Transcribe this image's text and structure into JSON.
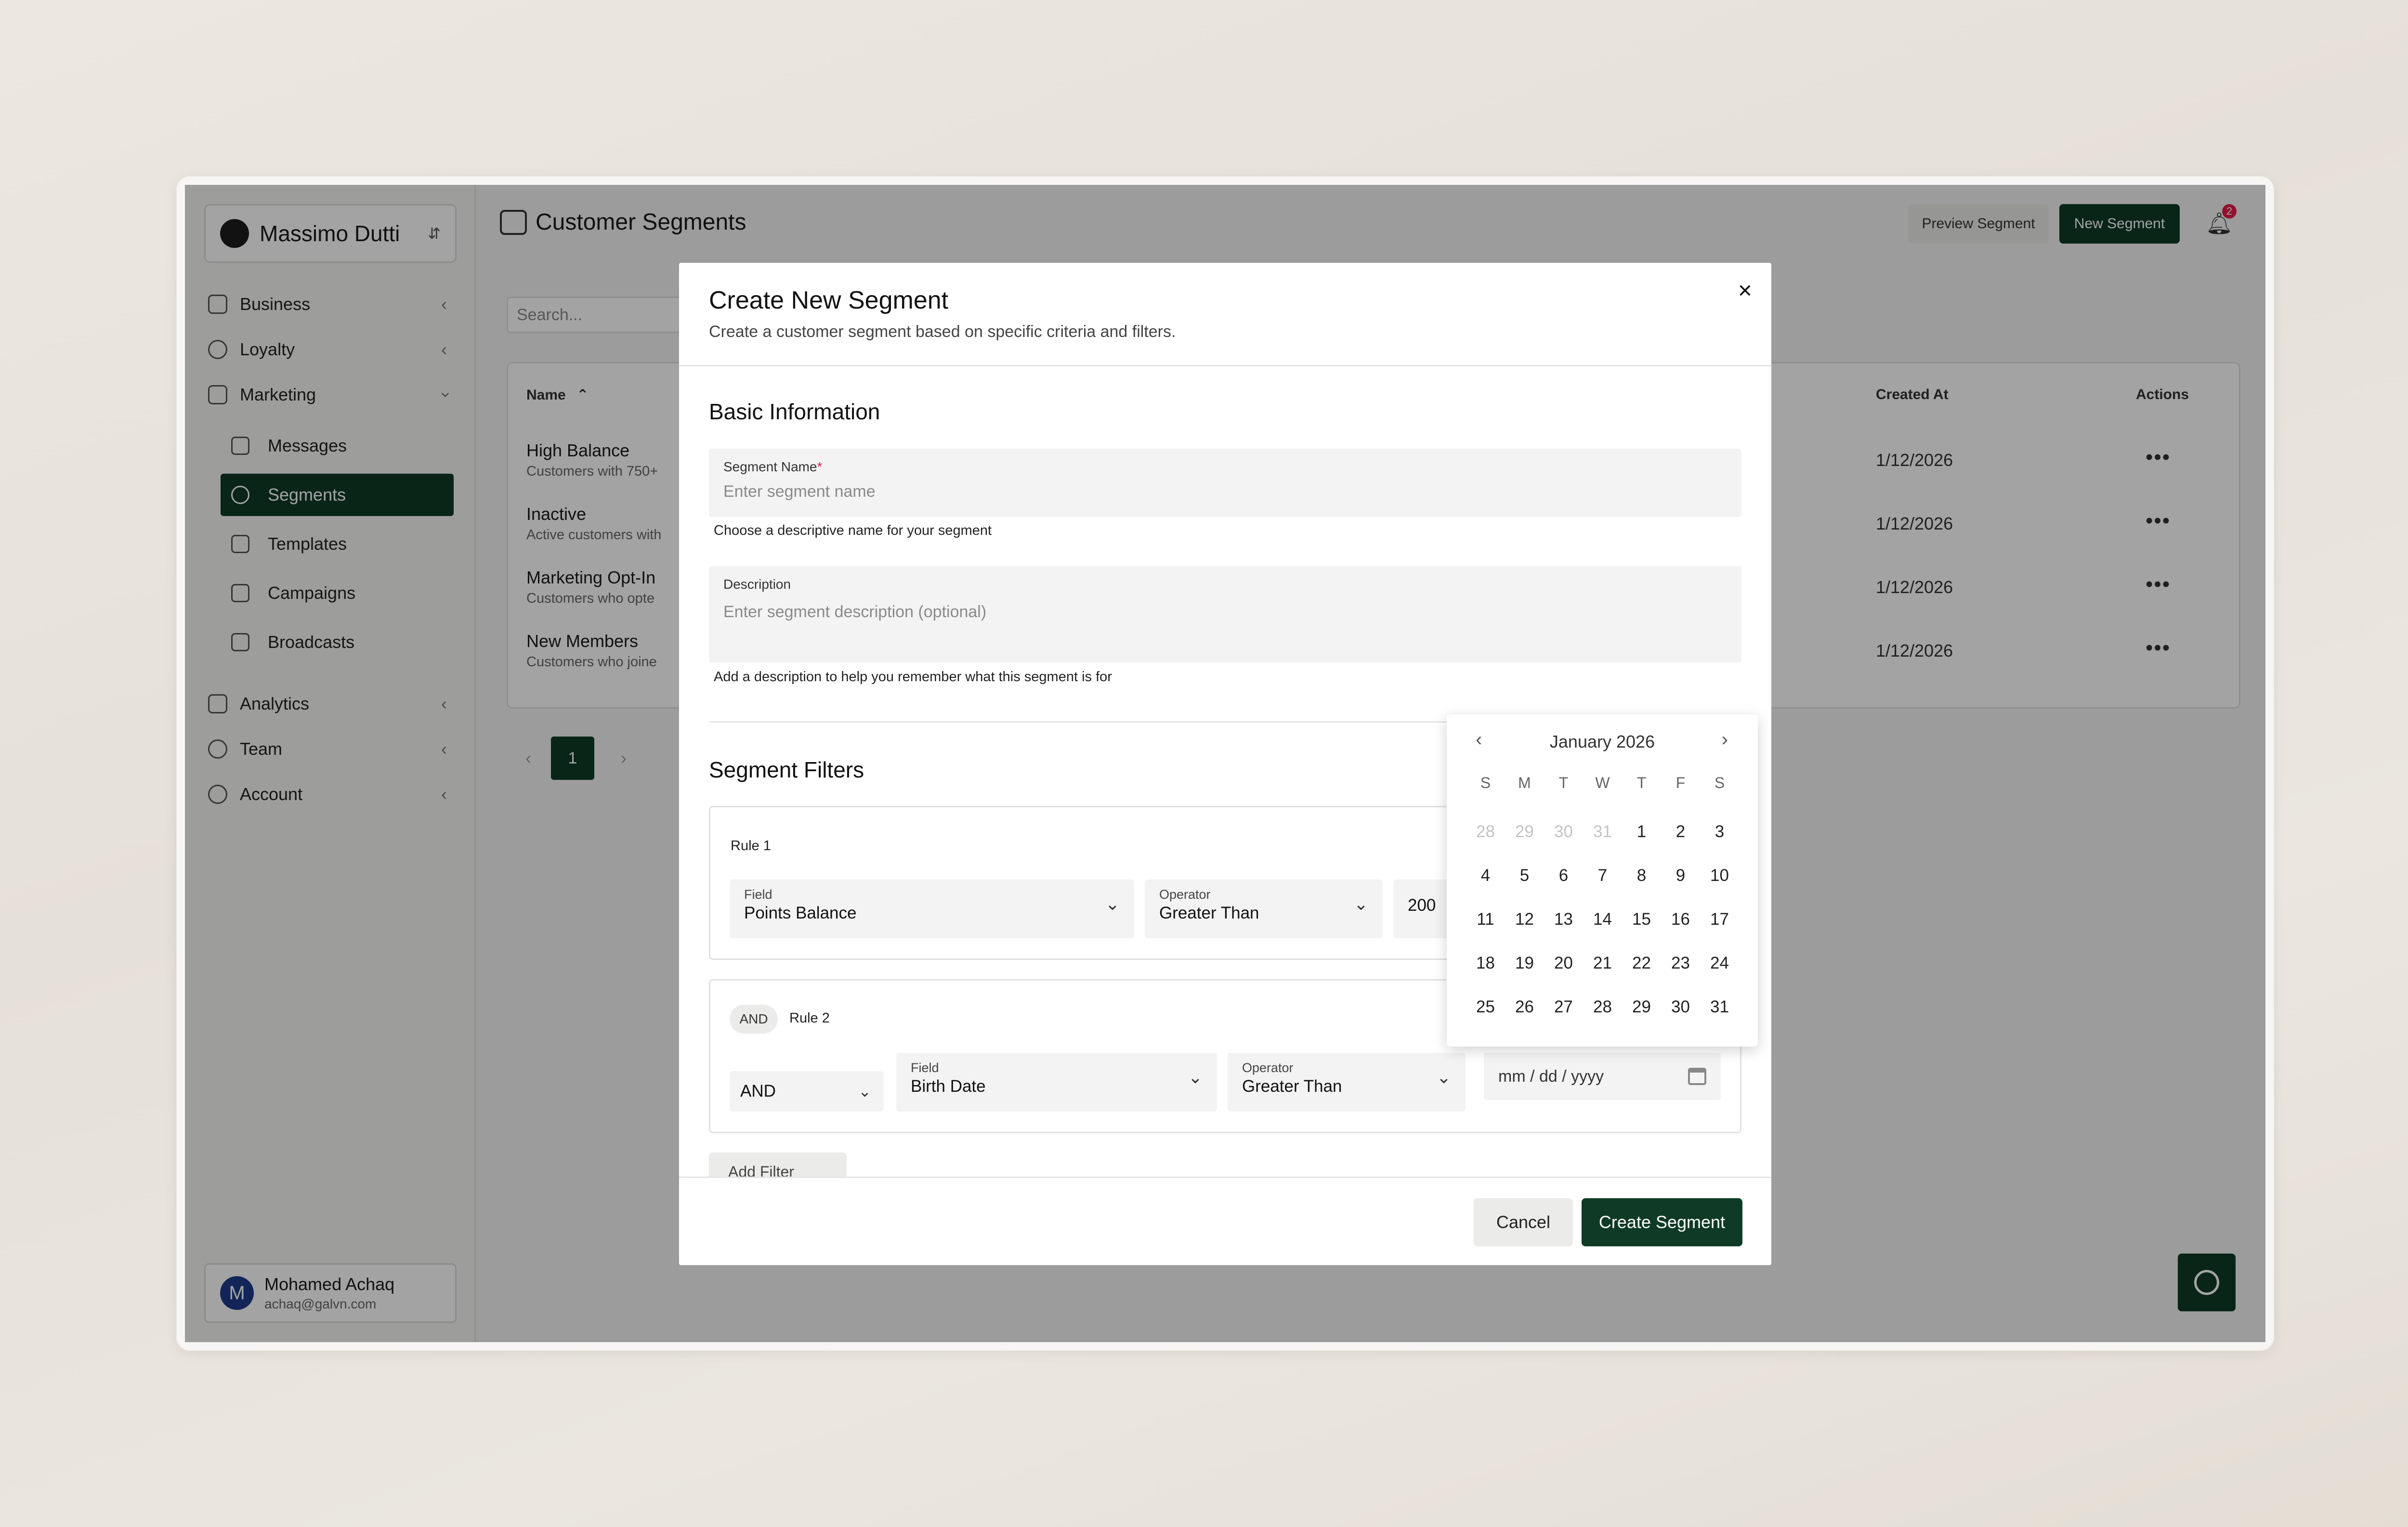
{
  "brand": {
    "name": "Massimo Dutti"
  },
  "sidebar": {
    "items": [
      {
        "label": "Business"
      },
      {
        "label": "Loyalty"
      },
      {
        "label": "Marketing"
      },
      {
        "label": "Analytics"
      },
      {
        "label": "Team"
      },
      {
        "label": "Account"
      }
    ],
    "marketing_sub": [
      {
        "label": "Messages"
      },
      {
        "label": "Segments"
      },
      {
        "label": "Templates"
      },
      {
        "label": "Campaigns"
      },
      {
        "label": "Broadcasts"
      }
    ],
    "user": {
      "initial": "M",
      "name": "Mohamed Achaq",
      "email": "achaq@galvn.com"
    }
  },
  "header": {
    "title": "Customer Segments",
    "preview_label": "Preview Segment",
    "new_label": "New Segment",
    "notification_count": "2"
  },
  "search": {
    "placeholder": "Search..."
  },
  "table": {
    "headers": {
      "name": "Name",
      "created_at": "Created At",
      "actions": "Actions"
    },
    "sort_glyph": "⌃",
    "rows": [
      {
        "name": "High Balance",
        "desc": "Customers with 750+",
        "created": "1/12/2026"
      },
      {
        "name": "Inactive",
        "desc": "Active customers with",
        "created": "1/12/2026"
      },
      {
        "name": "Marketing Opt-In",
        "desc": "Customers who opte",
        "created": "1/12/2026"
      },
      {
        "name": "New Members",
        "desc": "Customers who joine",
        "created": "1/12/2026"
      }
    ],
    "actions_glyph": "•••"
  },
  "pagination": {
    "prev": "‹",
    "current": "1",
    "next": "›"
  },
  "modal": {
    "title": "Create New Segment",
    "subtitle": "Create a customer segment based on specific criteria and filters.",
    "close_glyph": "×",
    "basic_info_title": "Basic Information",
    "segment_name": {
      "label": "Segment Name",
      "required_mark": "*",
      "placeholder": "Enter segment name",
      "helper": "Choose a descriptive name for your segment"
    },
    "description": {
      "label": "Description",
      "placeholder": "Enter segment description (optional)",
      "helper": "Add a description to help you remember what this segment is for"
    },
    "filters_title": "Segment Filters",
    "rule1": {
      "label": "Rule 1",
      "field_label": "Field",
      "field_value": "Points Balance",
      "operator_label": "Operator",
      "operator_value": "Greater Than",
      "value": "200"
    },
    "rule2": {
      "chip": "AND",
      "label": "Rule 2",
      "connector": "AND",
      "field_label": "Field",
      "field_value": "Birth Date",
      "operator_label": "Operator",
      "operator_value": "Greater Than",
      "date_placeholder": "mm / dd / yyyy"
    },
    "add_filter": "Add Filter",
    "cancel": "Cancel",
    "create": "Create Segment"
  },
  "calendar": {
    "month": "January 2026",
    "prev": "‹",
    "next": "›",
    "days_of_week": [
      "S",
      "M",
      "T",
      "W",
      "T",
      "F",
      "S"
    ],
    "weeks": [
      [
        "28",
        "29",
        "30",
        "31",
        "1",
        "2",
        "3"
      ],
      [
        "4",
        "5",
        "6",
        "7",
        "8",
        "9",
        "10"
      ],
      [
        "11",
        "12",
        "13",
        "14",
        "15",
        "16",
        "17"
      ],
      [
        "18",
        "19",
        "20",
        "21",
        "22",
        "23",
        "24"
      ],
      [
        "25",
        "26",
        "27",
        "28",
        "29",
        "30",
        "31"
      ]
    ],
    "muted_first_row_count": 4
  },
  "colors": {
    "accent": "#0f3b26",
    "badge": "#e11d48",
    "avatar": "#1e3a8a"
  }
}
